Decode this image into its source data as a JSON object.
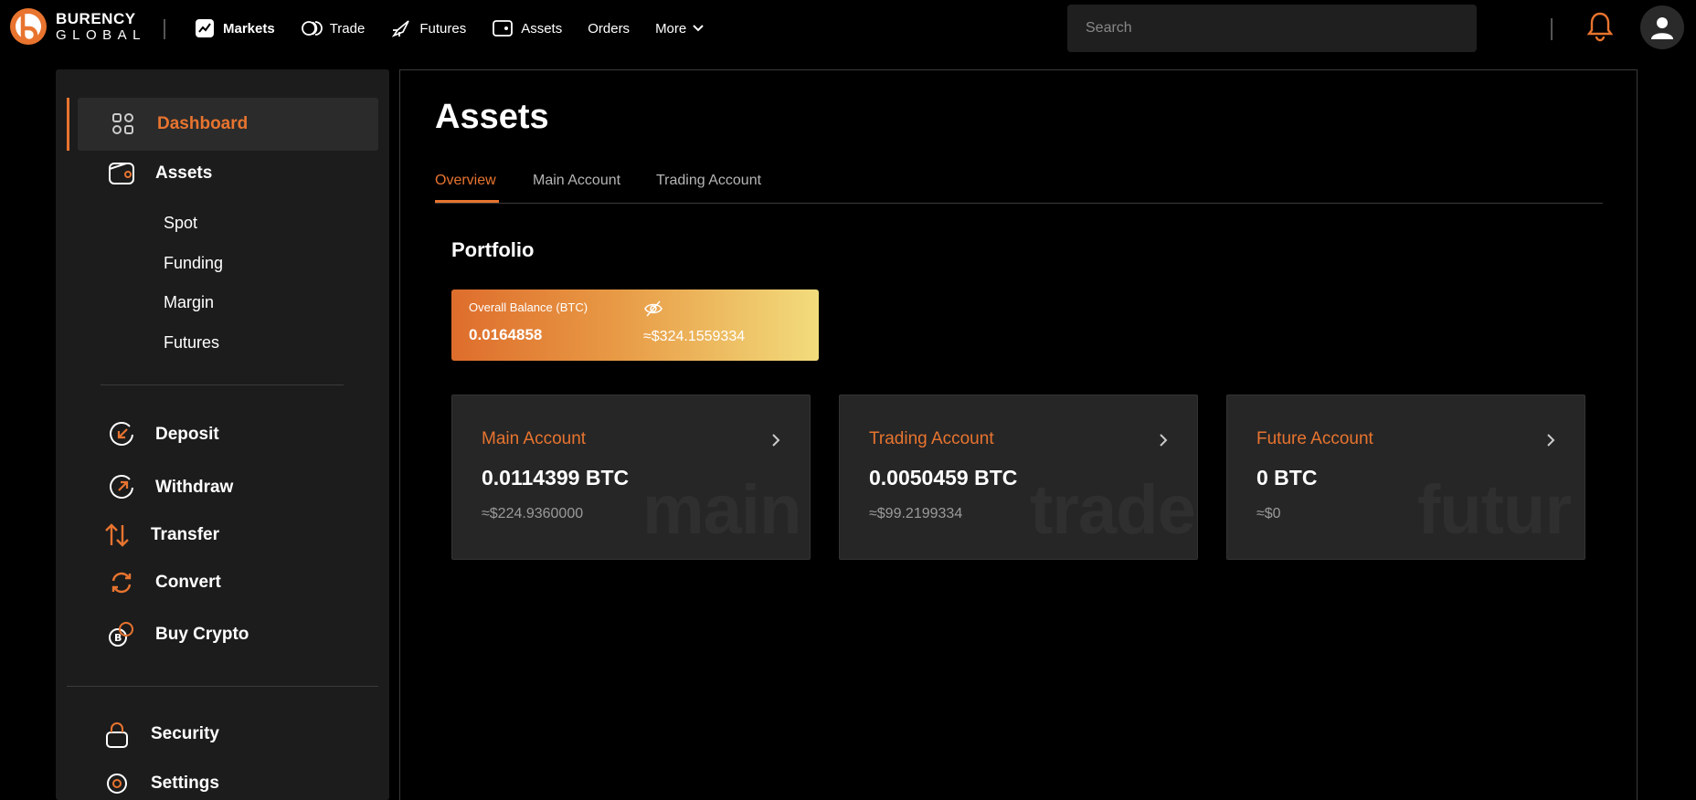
{
  "brand": {
    "line1": "BURENCY",
    "line2": "GLOBAL"
  },
  "nav": {
    "items": [
      {
        "label": "Markets",
        "icon": "chart-icon"
      },
      {
        "label": "Trade",
        "icon": "coins-icon"
      },
      {
        "label": "Futures",
        "icon": "rocket-icon"
      },
      {
        "label": "Assets",
        "icon": "wallet-icon"
      },
      {
        "label": "Orders"
      },
      {
        "label": "More",
        "icon": "chevron-down-icon"
      }
    ],
    "search_placeholder": "Search"
  },
  "colors": {
    "accent": "#e8742f",
    "background": "#000000",
    "panel": "#1c1c1c",
    "card": "#262626"
  },
  "sidebar": {
    "dashboard": "Dashboard",
    "assets": "Assets",
    "assets_sub": [
      "Spot",
      "Funding",
      "Margin",
      "Futures"
    ],
    "deposit": "Deposit",
    "withdraw": "Withdraw",
    "transfer": "Transfer",
    "convert": "Convert",
    "buy_crypto": "Buy Crypto",
    "security": "Security",
    "settings": "Settings"
  },
  "main": {
    "title": "Assets",
    "tabs": [
      "Overview",
      "Main Account",
      "Trading Account"
    ],
    "portfolio_title": "Portfolio",
    "balance": {
      "label": "Overall Balance (BTC)",
      "btc": "0.0164858",
      "usd": "≈$324.1559334"
    },
    "accounts": [
      {
        "name": "Main Account",
        "btc": "0.0114399 BTC",
        "usd": "≈$224.9360000",
        "watermark": "main"
      },
      {
        "name": "Trading Account",
        "btc": "0.0050459 BTC",
        "usd": "≈$99.2199334",
        "watermark": "trade"
      },
      {
        "name": "Future Account",
        "btc": "0 BTC",
        "usd": "≈$0",
        "watermark": "futur"
      }
    ]
  }
}
